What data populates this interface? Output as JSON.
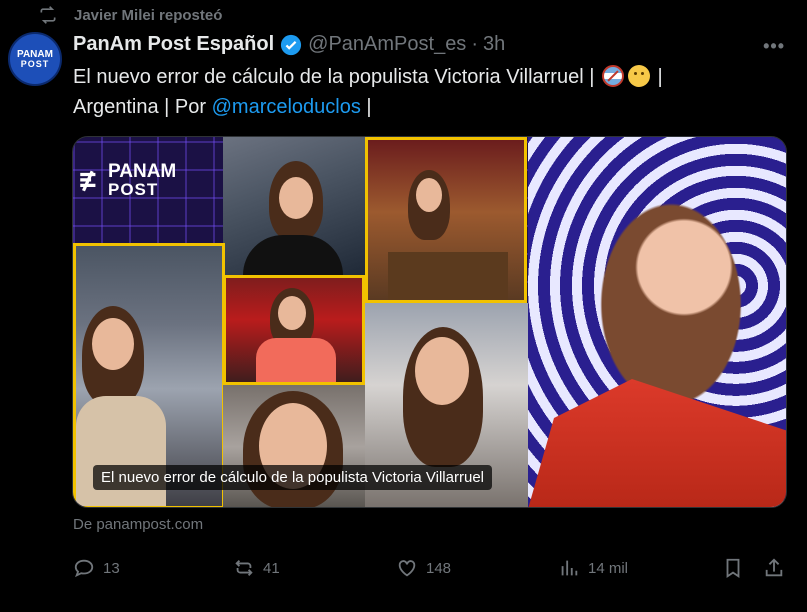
{
  "repost": {
    "text": "Javier Milei reposteó"
  },
  "author": {
    "name": "PanAm Post Español",
    "handle": "@PanAmPost_es",
    "time": "3h",
    "avatar_line1": "PANAM",
    "avatar_line2": "POST"
  },
  "tweet": {
    "text_part1": "El nuevo error de cálculo de la populista Victoria Villarruel |",
    "text_part2": "|",
    "text_part3": "Argentina | Por",
    "mention": "@marceloduclos",
    "text_part4": "|"
  },
  "card": {
    "logo_line1": "PANAM",
    "logo_line2": "POST",
    "caption": "El nuevo error de cálculo de la populista Victoria Villarruel"
  },
  "source": {
    "text": "De panampost.com"
  },
  "actions": {
    "replies": "13",
    "reposts": "41",
    "likes": "148",
    "views": "14 mil"
  },
  "colors": {
    "background": "#000000",
    "text": "#e7e9ea",
    "muted": "#71767b",
    "link": "#1d9bf0",
    "verified": "#1d9bf0",
    "accent_yellow": "#f2c200"
  },
  "icons": [
    "repost-icon",
    "verified-icon",
    "more-icon",
    "reply-icon",
    "like-icon",
    "views-icon",
    "bookmark-icon",
    "share-icon"
  ]
}
